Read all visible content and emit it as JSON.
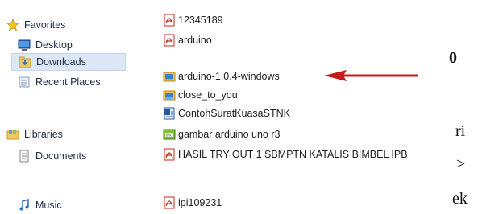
{
  "nav": {
    "favorites": "Favorites",
    "desktop": "Desktop",
    "downloads": "Downloads",
    "recent_places": "Recent Places",
    "libraries": "Libraries",
    "documents": "Documents",
    "music": "Music"
  },
  "files": [
    {
      "name": "12345189",
      "icon": "pdf-icon"
    },
    {
      "name": "arduino",
      "icon": "pdf-icon"
    },
    {
      "name": "arduino-1.0.4-windows",
      "icon": "zip-archive-icon"
    },
    {
      "name": "close_to_you",
      "icon": "zip-archive-icon"
    },
    {
      "name": "ContohSuratKuasaSTNK",
      "icon": "word-document-icon"
    },
    {
      "name": "gambar arduino uno r3",
      "icon": "image-file-icon"
    },
    {
      "name": "HASIL TRY OUT 1 SBMPTN KATALIS BIMBEL IPB",
      "icon": "pdf-icon"
    },
    {
      "name": "ipi109231",
      "icon": "pdf-icon"
    }
  ],
  "background_text": {
    "line1": "0",
    "line2": "ri",
    "line3": ">",
    "line4": "ek"
  },
  "colors": {
    "arrow": "#c41a1a",
    "selection": "#dde8f6",
    "pdf": "#c8281e"
  }
}
